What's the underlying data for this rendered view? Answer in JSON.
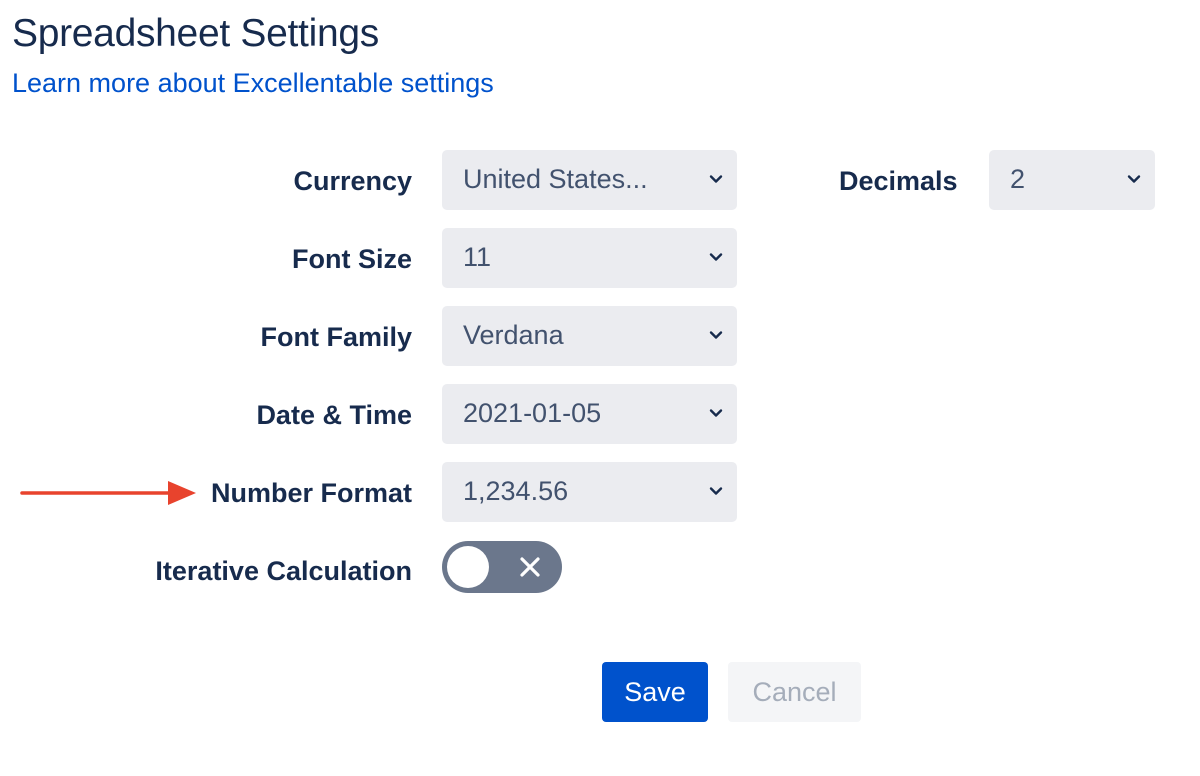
{
  "header": {
    "title": "Spreadsheet Settings",
    "learn_more_link": "Learn more about Excellentable settings"
  },
  "settings": {
    "currency": {
      "label": "Currency",
      "value": "United States..."
    },
    "decimals": {
      "label": "Decimals",
      "value": "2"
    },
    "font_size": {
      "label": "Font Size",
      "value": "11"
    },
    "font_family": {
      "label": "Font Family",
      "value": "Verdana"
    },
    "date_time": {
      "label": "Date & Time",
      "value": "2021-01-05"
    },
    "number_format": {
      "label": "Number Format",
      "value": "1,234.56"
    },
    "iterative_calculation": {
      "label": "Iterative Calculation",
      "enabled": false
    }
  },
  "actions": {
    "save_label": "Save",
    "cancel_label": "Cancel"
  },
  "colors": {
    "accent": "#0052cc",
    "text": "#172b4d",
    "select_bg": "#ebecf0",
    "toggle_off": "#6b778c",
    "annotation_arrow": "#e8432d"
  },
  "icons": {
    "select_chevron": "chevron-down-icon",
    "toggle_off": "close-icon",
    "annotation": "arrow-right-icon"
  }
}
